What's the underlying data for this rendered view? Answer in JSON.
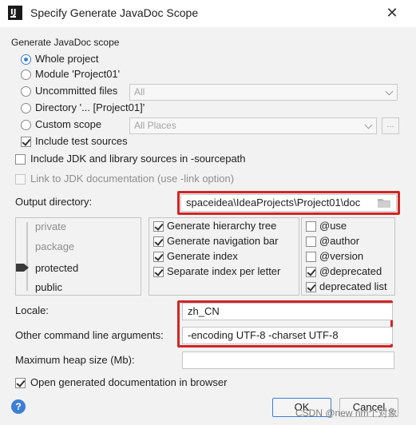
{
  "window": {
    "title": "Specify Generate JavaDoc Scope",
    "app_icon_letters": "IJ",
    "close_glyph": "✕"
  },
  "scope": {
    "section_title": "Generate JavaDoc scope",
    "options": [
      {
        "label": "Whole project",
        "selected": true
      },
      {
        "label": "Module 'Project01'",
        "selected": false
      },
      {
        "label": "Uncommitted files",
        "selected": false
      },
      {
        "label": "Directory '... [Project01]'",
        "selected": false
      },
      {
        "label": "Custom scope",
        "selected": false
      }
    ],
    "uncommitted_combo": "All",
    "custom_scope_combo": "All Places",
    "custom_scope_button": "...",
    "include_test_sources": "Include test sources"
  },
  "options": {
    "include_jdk": "Include JDK and library sources in -sourcepath",
    "link_jdk": "Link to JDK documentation (use -link option)",
    "output_dir_label": "Output directory:",
    "output_dir_value": "spaceidea\\IdeaProjects\\Project01\\doc"
  },
  "visibility": {
    "levels": [
      "private",
      "package",
      "protected",
      "public"
    ],
    "selected": "protected"
  },
  "generate": {
    "items": [
      {
        "label": "Generate hierarchy tree",
        "checked": true
      },
      {
        "label": "Generate navigation bar",
        "checked": true
      },
      {
        "label": "Generate index",
        "checked": true
      },
      {
        "label": "Separate index per letter",
        "checked": true
      }
    ]
  },
  "tags": {
    "items": [
      {
        "label": "@use",
        "checked": false
      },
      {
        "label": "@author",
        "checked": false
      },
      {
        "label": "@version",
        "checked": false
      },
      {
        "label": "@deprecated",
        "checked": true
      },
      {
        "label": "deprecated list",
        "checked": true
      }
    ]
  },
  "fields": {
    "locale_label": "Locale:",
    "locale_value": "zh_CN",
    "args_label": "Other command line arguments:",
    "args_value": "-encoding UTF-8 -charset UTF-8",
    "heap_label": "Maximum heap size (Mb):",
    "heap_value": ""
  },
  "footer": {
    "open_in_browser": "Open generated documentation in browser",
    "help_glyph": "?",
    "ok_label": "OK",
    "cancel_label": "Cancel",
    "watermark": "CSDN @new nm个对象"
  },
  "colors": {
    "accent": "#3d7fd6",
    "highlight_box": "#d32424",
    "dialog_bg": "#f2f2f2"
  },
  "icons": [
    "close-icon",
    "folder-icon",
    "help-icon",
    "chevron-down-icon",
    "slider-thumb-icon"
  ]
}
